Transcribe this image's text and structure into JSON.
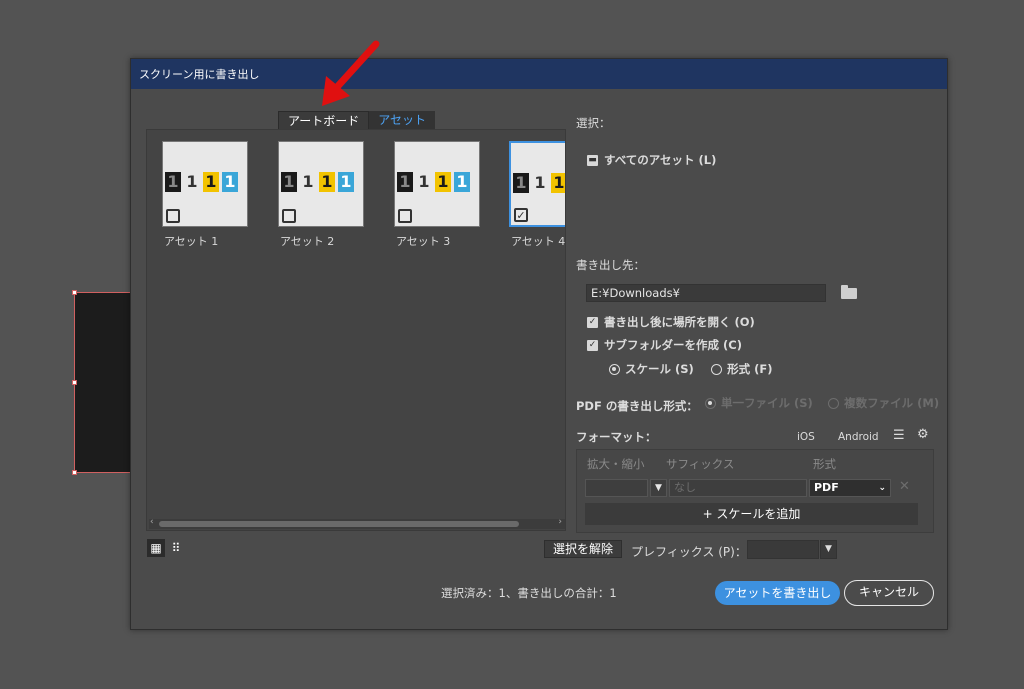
{
  "dialog": {
    "title": "スクリーン用に書き出し",
    "tabs": [
      {
        "label": "アートボード"
      },
      {
        "label": "アセット"
      }
    ],
    "assets": [
      {
        "label": "アセット 1",
        "checked": false,
        "selected": false
      },
      {
        "label": "アセット 2",
        "checked": false,
        "selected": false
      },
      {
        "label": "アセット 3",
        "checked": false,
        "selected": false
      },
      {
        "label": "アセット 4",
        "checked": true,
        "selected": true
      }
    ],
    "thumb_digits": [
      "1",
      "1",
      "1",
      "1"
    ],
    "selection": {
      "heading": "選択：",
      "all_assets": "すべてのアセット (L)"
    },
    "destination": {
      "heading": "書き出し先：",
      "path": "E:¥Downloads¥",
      "open_after": "書き出し後に場所を開く (O)",
      "create_subfolder": "サブフォルダーを作成 (C)",
      "scale_option": "スケール (S)",
      "format_option": "形式 (F)"
    },
    "pdf": {
      "label": "PDF の書き出し形式：",
      "single": "単一ファイル (S)",
      "multiple": "複数ファイル (M)"
    },
    "formats": {
      "heading": "フォーマット：",
      "ios": "iOS",
      "android": "Android",
      "col_scale": "拡大・縮小",
      "col_suffix": "サフィックス",
      "col_format": "形式",
      "suffix_placeholder": "なし",
      "format_value": "PDF",
      "add_scale": "+ スケールを追加"
    },
    "deselect_label": "選択を解除",
    "prefix_label": "プレフィックス (P)：",
    "summary": "選択済み：1、書き出しの合計：1",
    "export_label": "アセットを書き出し",
    "cancel_label": "キャンセル"
  },
  "colors": {
    "titlebar": "#1f3561",
    "accent": "#3d91e0",
    "annotation_arrow": "#e01010"
  }
}
